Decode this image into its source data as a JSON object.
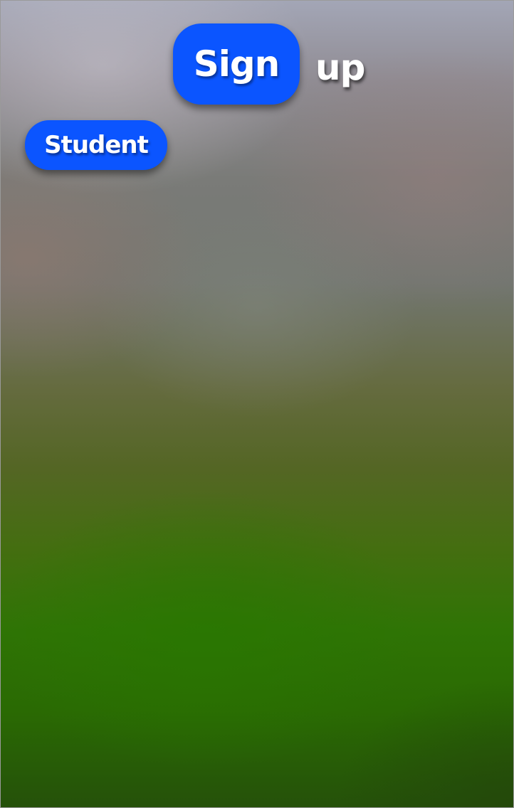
{
  "header": {
    "sign_label": "Sign",
    "up_label": "up"
  },
  "roles": {
    "student_label": "Student"
  },
  "colors": {
    "button_blue": "#0b55ff",
    "text_white": "#ffffff"
  }
}
